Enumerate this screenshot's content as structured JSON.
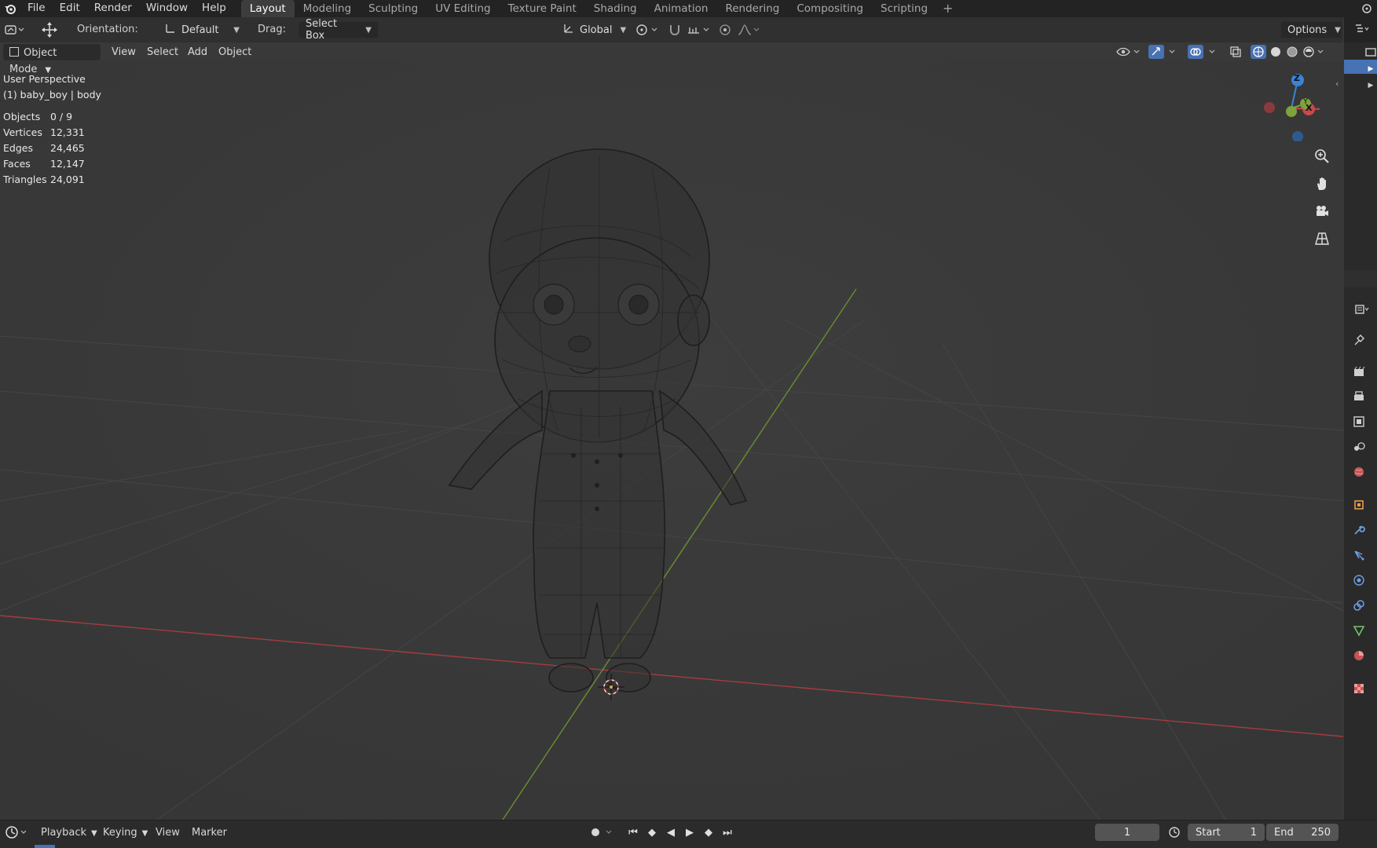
{
  "menubar": {
    "items": [
      "File",
      "Edit",
      "Render",
      "Window",
      "Help"
    ],
    "workspaces": [
      "Layout",
      "Modeling",
      "Sculpting",
      "UV Editing",
      "Texture Paint",
      "Shading",
      "Animation",
      "Rendering",
      "Compositing",
      "Scripting"
    ],
    "active_workspace": "Layout",
    "add_tab": "+"
  },
  "toolbar": {
    "orientation_label": "Orientation:",
    "orientation_value": "Default",
    "drag_label": "Drag:",
    "drag_value": "Select Box",
    "transform_value": "Global",
    "options_label": "Options"
  },
  "header": {
    "mode": "Object Mode",
    "menus": [
      "View",
      "Select",
      "Add",
      "Object"
    ]
  },
  "overlay": {
    "perspective": "User Perspective",
    "object": "(1) baby_boy | body",
    "stats": [
      {
        "key": "Objects",
        "value": "0 / 9"
      },
      {
        "key": "Vertices",
        "value": "12,331"
      },
      {
        "key": "Edges",
        "value": "24,465"
      },
      {
        "key": "Faces",
        "value": "12,147"
      },
      {
        "key": "Triangles",
        "value": "24,091"
      }
    ]
  },
  "gizmo": {
    "z": "Z",
    "y": "Y",
    "x": "X"
  },
  "colors": {
    "x_axis": "#c8484c",
    "y_axis": "#7ea33c",
    "z_axis": "#3a83d6",
    "accent": "#4772b3"
  },
  "timeline": {
    "menus": [
      "Playback",
      "Keying",
      "View",
      "Marker"
    ],
    "current_frame": "1",
    "start_label": "Start",
    "start_value": "1",
    "end_label": "End",
    "end_value": "250"
  }
}
